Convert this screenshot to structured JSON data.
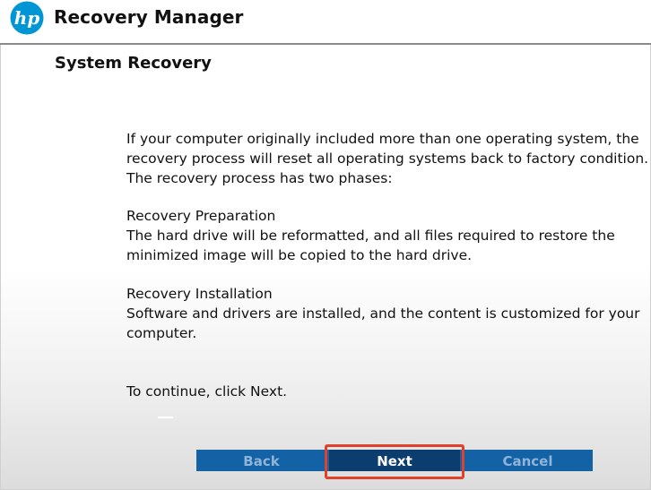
{
  "header": {
    "logo_text": "hp",
    "title": "Recovery Manager"
  },
  "page": {
    "title": "System Recovery"
  },
  "content": {
    "intro": [
      "If your computer originally included more than one operating system, the",
      "recovery process will reset all operating systems back to factory condition.",
      "The recovery process has two phases:"
    ],
    "phase1": {
      "heading": "Recovery Preparation",
      "lines": [
        "The hard drive will be reformatted, and all files required to restore the",
        "minimized image will be copied to the hard drive."
      ]
    },
    "phase2": {
      "heading": "Recovery Installation",
      "lines": [
        "Software and drivers are installed, and the content is customized for your",
        "computer."
      ]
    },
    "continue_text": "To continue, click Next."
  },
  "buttons": {
    "back": "Back",
    "next": "Next",
    "cancel": "Cancel"
  },
  "colors": {
    "button_bar": "#1462a6",
    "active_button": "#0b3d6e",
    "highlight": "#e1402b",
    "inactive_label": "#8fb4d8"
  }
}
